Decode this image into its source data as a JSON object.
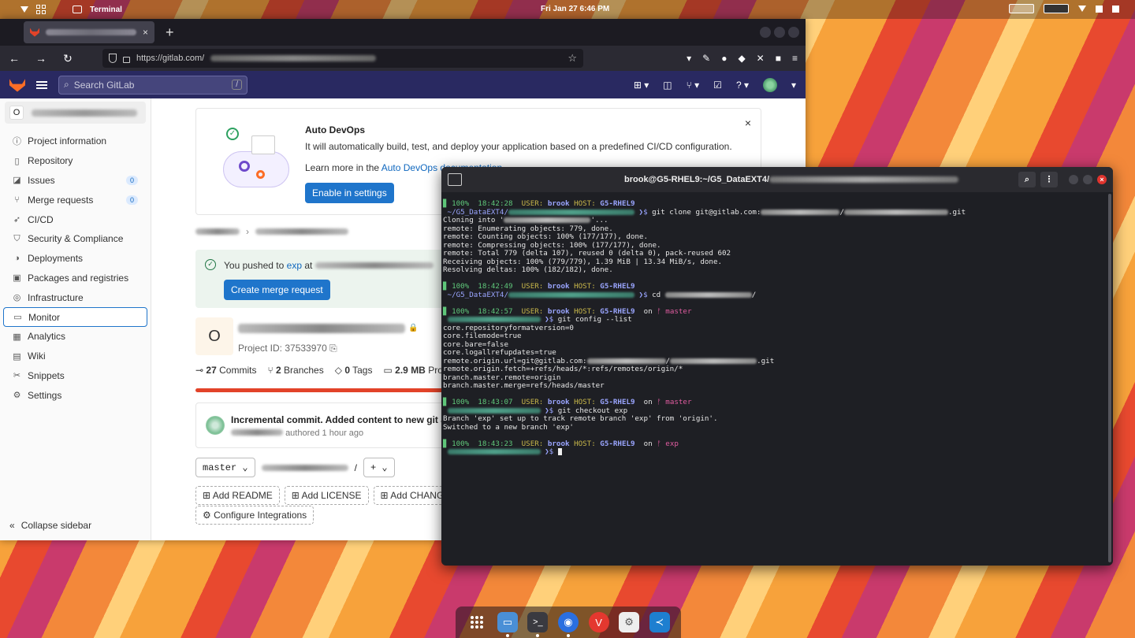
{
  "topbar": {
    "app_name": "Terminal",
    "clock": "Fri Jan 27  6:46 PM"
  },
  "browser": {
    "tab_close": "×",
    "new_tab": "+",
    "url_prefix": "https://gitlab.com/",
    "nav": {
      "back": "←",
      "forward": "→",
      "reload": "↻",
      "star": "☆"
    }
  },
  "gitlab": {
    "search_placeholder": "Search GitLab",
    "search_shortcut": "/",
    "project_initial": "O",
    "sidebar": [
      {
        "label": "Project information",
        "icon": "info-icon"
      },
      {
        "label": "Repository",
        "icon": "repository-icon"
      },
      {
        "label": "Issues",
        "icon": "issues-icon",
        "badge": "0"
      },
      {
        "label": "Merge requests",
        "icon": "merge-request-icon",
        "badge": "0"
      },
      {
        "label": "CI/CD",
        "icon": "rocket-icon"
      },
      {
        "label": "Security & Compliance",
        "icon": "shield-icon"
      },
      {
        "label": "Deployments",
        "icon": "deployments-icon"
      },
      {
        "label": "Packages and registries",
        "icon": "package-icon"
      },
      {
        "label": "Infrastructure",
        "icon": "infrastructure-icon"
      },
      {
        "label": "Monitor",
        "icon": "monitor-icon",
        "active": true
      },
      {
        "label": "Analytics",
        "icon": "chart-icon"
      },
      {
        "label": "Wiki",
        "icon": "book-icon"
      },
      {
        "label": "Snippets",
        "icon": "snippet-icon"
      },
      {
        "label": "Settings",
        "icon": "gear-icon"
      }
    ],
    "collapse_label": "Collapse sidebar",
    "devops": {
      "title": "Auto DevOps",
      "description": "It will automatically build, test, and deploy your application based on a predefined CI/CD configuration.",
      "learn_more": "Learn more in the ",
      "link": "Auto DevOps documentation",
      "button": "Enable in settings",
      "close": "×"
    },
    "push": {
      "prefix": "You pushed to ",
      "branch": "exp",
      "mid": " at ",
      "button": "Create merge request"
    },
    "project": {
      "avatar": "O",
      "id_label": "Project ID: 37533970"
    },
    "stats": {
      "commits": "27",
      "commits_label": "Commits",
      "branches": "2",
      "branches_label": "Branches",
      "tags": "0",
      "tags_label": "Tags",
      "size": "2.9 MB",
      "size_label": "Project Storage"
    },
    "commit": {
      "title": "Incremental commit. Added content to new git article",
      "authored": "authored 1 hour ago"
    },
    "branch_select": "master",
    "path_sep": "/",
    "add_btn": "+",
    "actions": [
      "Add README",
      "Add LICENSE",
      "Add CHANGELOG"
    ],
    "configure": "Configure Integrations"
  },
  "terminal": {
    "title": "brook@G5-RHEL9:~/G5_DataEXT4/",
    "prompts": [
      {
        "time": "18:42:28",
        "cmd": "git clone git@gitlab.com:",
        "cmd_tail": ".git",
        "branch": ""
      },
      {
        "time": "18:42:49",
        "cmd": "cd ",
        "cmd_tail": "/",
        "branch": ""
      },
      {
        "time": "18:42:57",
        "cmd": "git config --list",
        "cmd_tail": "",
        "branch": "master"
      },
      {
        "time": "18:43:07",
        "cmd": "git checkout exp",
        "cmd_tail": "",
        "branch": "master"
      },
      {
        "time": "18:43:23",
        "cmd": "",
        "cmd_tail": "",
        "branch": "exp"
      }
    ],
    "battery": "100%",
    "user_label": "USER:",
    "user": "brook",
    "host_label": "HOST:",
    "host": "G5-RHEL9",
    "on": "on",
    "path": "~/G5_DataEXT4/",
    "clone_output": [
      "Cloning into '",
      "remote: Enumerating objects: 779, done.",
      "remote: Counting objects: 100% (177/177), done.",
      "remote: Compressing objects: 100% (177/177), done.",
      "remote: Total 779 (delta 107), reused 0 (delta 0), pack-reused 602",
      "Receiving objects: 100% (779/779), 1.39 MiB | 13.34 MiB/s, done.",
      "Resolving deltas: 100% (182/182), done."
    ],
    "clone_tail": "'...",
    "config_output": [
      "core.repositoryformatversion=0",
      "core.filemode=true",
      "core.bare=false",
      "core.logallrefupdates=true",
      "remote.origin.url=git@gitlab.com:",
      "remote.origin.fetch=+refs/heads/*:refs/remotes/origin/*",
      "branch.master.remote=origin",
      "branch.master.merge=refs/heads/master"
    ],
    "config_url_tail": ".git",
    "checkout_output": [
      "Branch 'exp' set up to track remote branch 'exp' from 'origin'.",
      "Switched to a new branch 'exp'"
    ]
  },
  "colors": {
    "gitlab_header": "#292961",
    "gitlab_blue": "#1f75cb",
    "terminal_bg": "#1e1f24"
  }
}
